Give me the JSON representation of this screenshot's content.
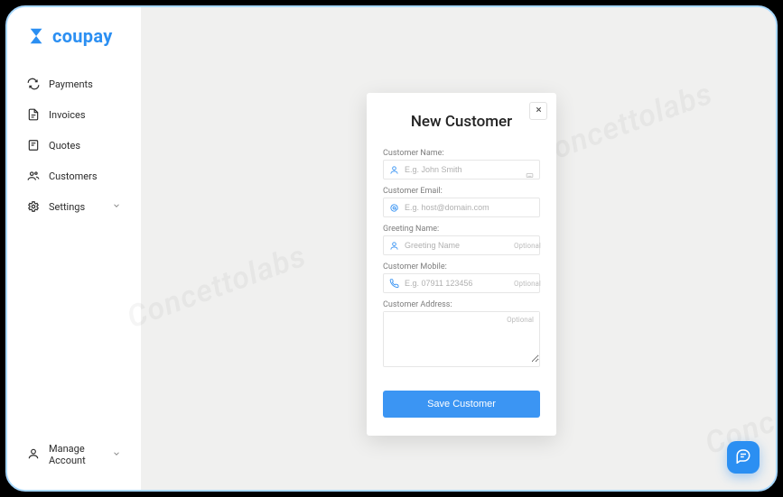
{
  "brand": {
    "name": "coupay",
    "accent": "#2b8ff2"
  },
  "sidebar": {
    "items": [
      {
        "label": "Payments"
      },
      {
        "label": "Invoices"
      },
      {
        "label": "Quotes"
      },
      {
        "label": "Customers"
      },
      {
        "label": "Settings"
      }
    ],
    "manage_label": "Manage Account"
  },
  "modal": {
    "title": "New Customer",
    "fields": {
      "name": {
        "label": "Customer Name:",
        "placeholder": "E.g. John Smith"
      },
      "email": {
        "label": "Customer Email:",
        "placeholder": "E.g. host@domain.com"
      },
      "greeting": {
        "label": "Greeting Name:",
        "placeholder": "Greeting Name",
        "optional": "Optional"
      },
      "mobile": {
        "label": "Customer Mobile:",
        "placeholder": "E.g. 07911 123456",
        "optional": "Optional"
      },
      "address": {
        "label": "Customer Address:",
        "optional": "Optional"
      }
    },
    "save_label": "Save Customer"
  },
  "watermark": "Concettolabs"
}
